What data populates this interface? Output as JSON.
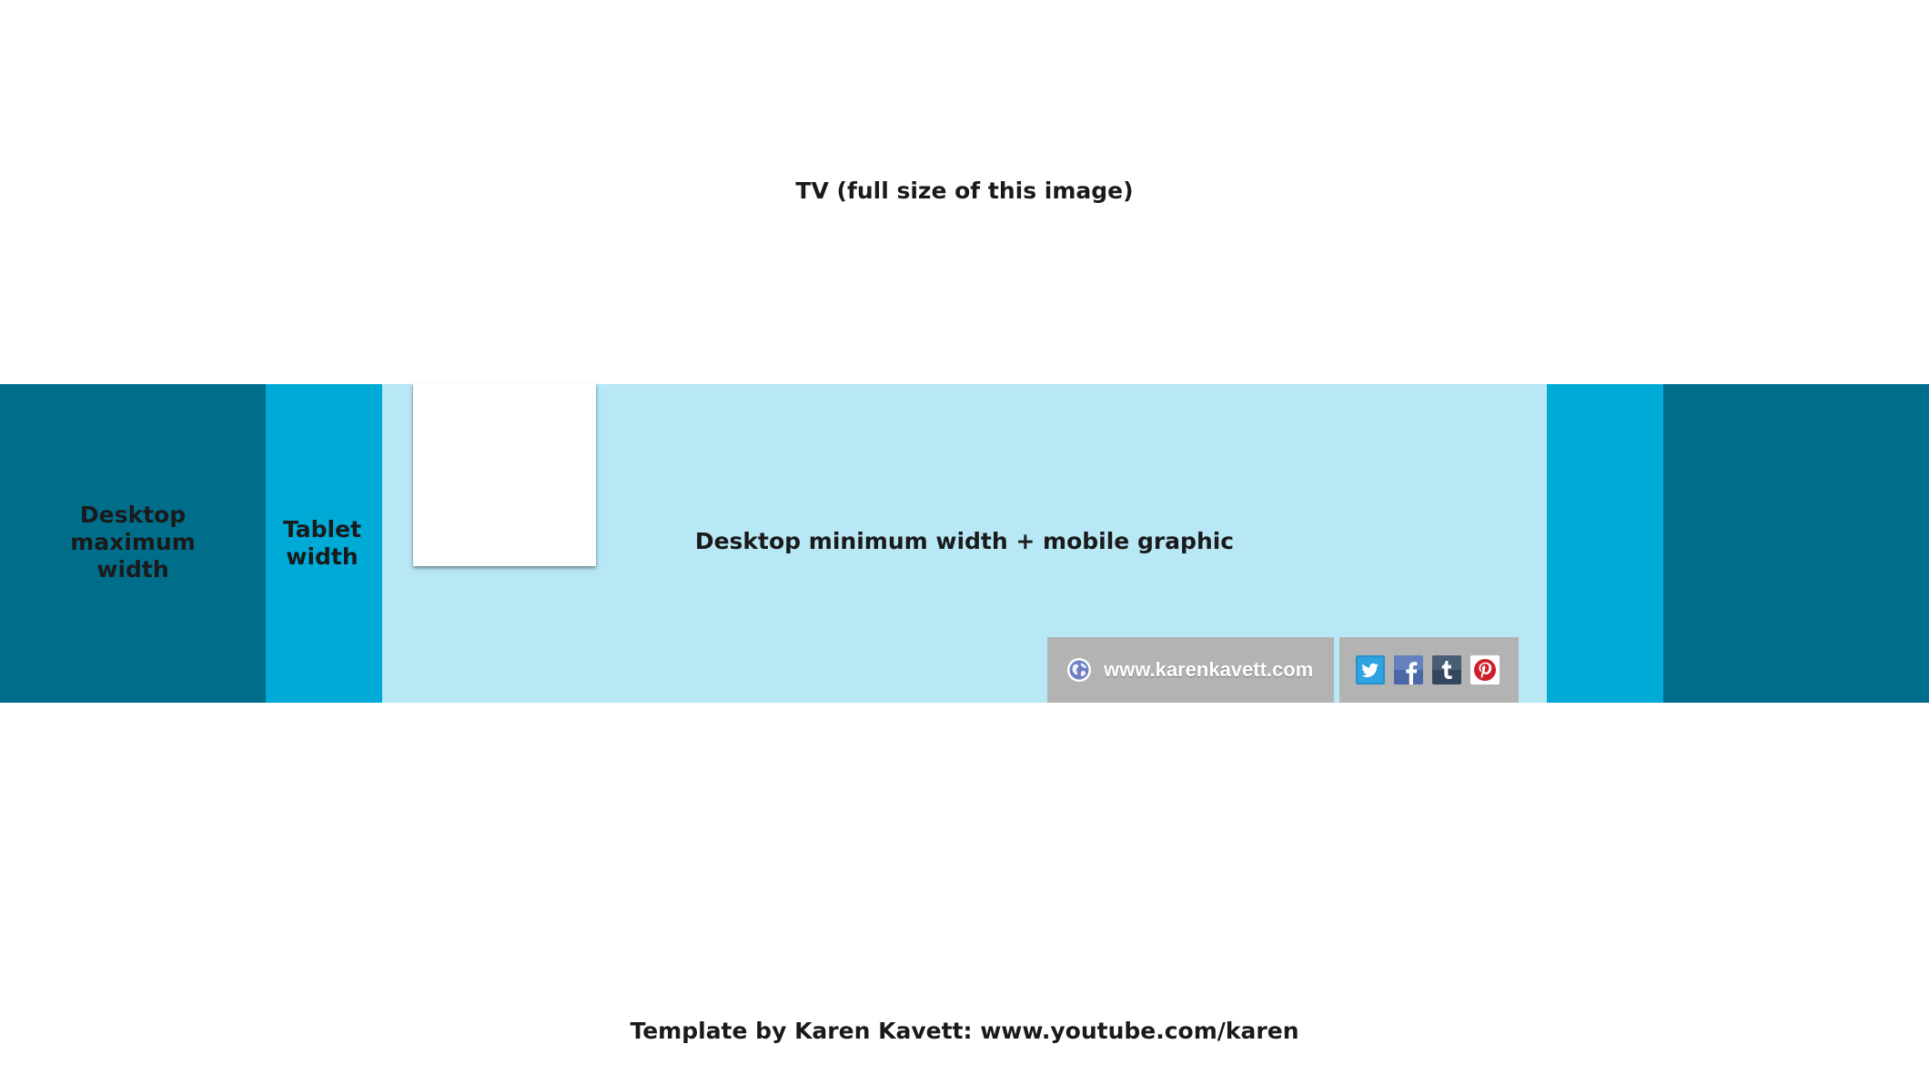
{
  "tv_label": "TV (full size of this image)",
  "zones": {
    "desktop_max_label": "Desktop maximum width",
    "tablet_label": "Tablet width",
    "desktop_min_label": "Desktop minimum width + mobile graphic"
  },
  "links": {
    "website": "www.karenkavett.com",
    "social_icons": [
      "twitter-icon",
      "facebook-icon",
      "tumblr-icon",
      "pinterest-icon"
    ]
  },
  "footer_credit": "Template by Karen Kavett: www.youtube.com/karen",
  "colors": {
    "desktop_max": "#006e8b",
    "tablet": "#00aad6",
    "desktop_min": "#b8e8f5",
    "link_bar": "#b3b3b3",
    "text": "#1a1a1a"
  }
}
